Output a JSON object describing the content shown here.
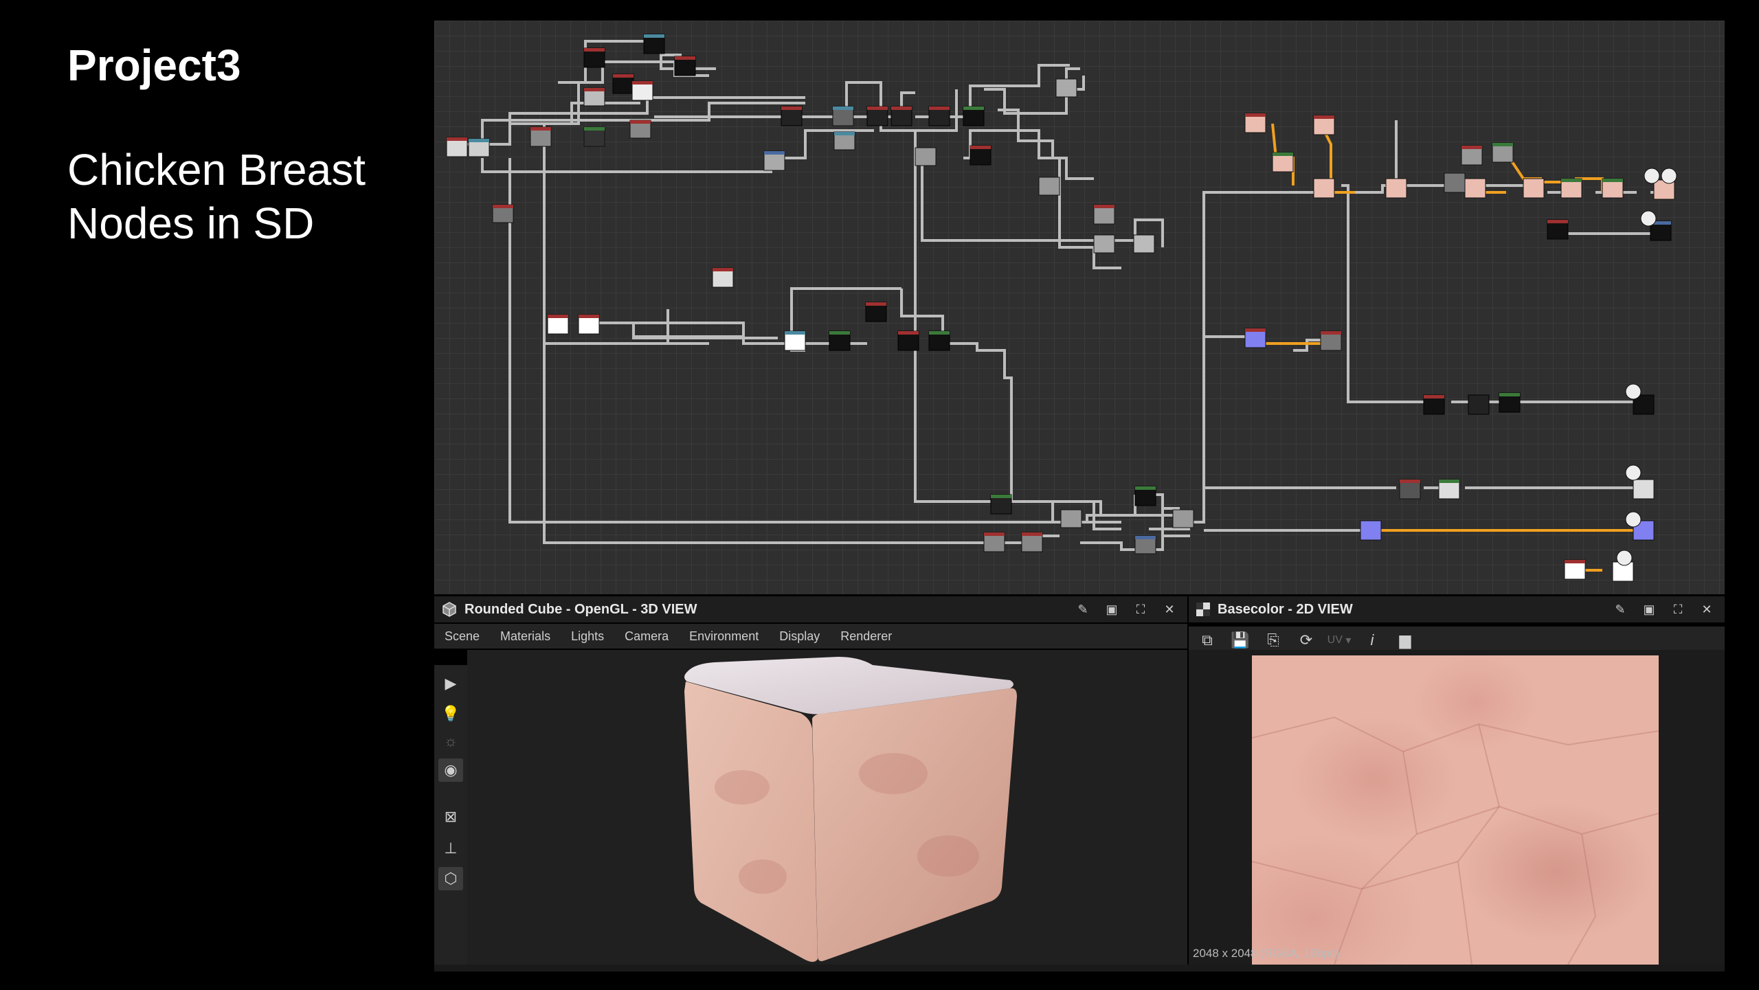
{
  "slide": {
    "title": "Project3",
    "subtitle_line1": "Chicken Breast",
    "subtitle_line2": "Nodes in SD"
  },
  "view3d": {
    "title": "Rounded Cube - OpenGL - 3D VIEW",
    "menu": [
      "Scene",
      "Materials",
      "Lights",
      "Camera",
      "Environment",
      "Display",
      "Renderer"
    ]
  },
  "view2d": {
    "title": "Basecolor - 2D VIEW",
    "uv_label": "UV",
    "resolution": "2048 x 2048 (RGBA, 16bpc)"
  },
  "colors": {
    "graph_bg": "#2f2f2f",
    "wire": "#bdbdbd",
    "highlight_wire": "#f0a020",
    "skin": "#e6b3a5"
  }
}
